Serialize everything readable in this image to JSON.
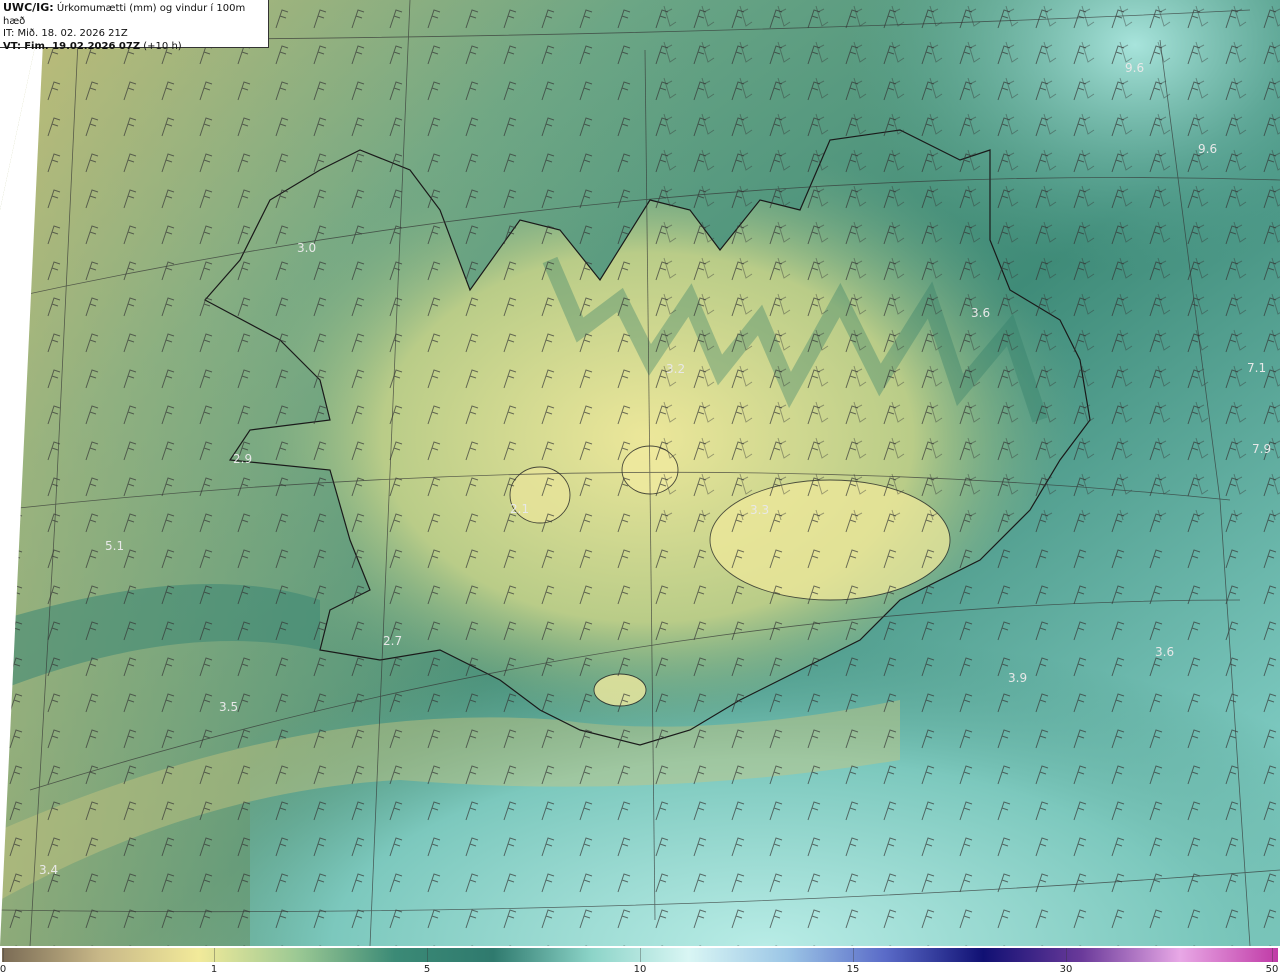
{
  "title": {
    "product": "UWC/IG:",
    "description": "Úrkomumætti (mm) og vindur í 100m hæð",
    "init_time": "IT: Mið. 18. 02. 2026 21Z",
    "valid_label": "VT:",
    "valid_time": "Fim. 19.02.2026 07Z",
    "lead": "(+10 h)"
  },
  "map_labels": [
    {
      "text": "3.0",
      "name": "value-label-westfjords"
    },
    {
      "text": "3.2",
      "name": "value-label-north"
    },
    {
      "text": "3.6",
      "name": "value-label-northeast"
    },
    {
      "text": "7.1",
      "name": "value-label-east-sea"
    },
    {
      "text": "7.9",
      "name": "value-label-east-sea-2"
    },
    {
      "text": "9.6",
      "name": "value-label-northeast-sea"
    },
    {
      "text": "9.6",
      "name": "value-label-far-northeast"
    },
    {
      "text": "2.9",
      "name": "value-label-snaefellsnes"
    },
    {
      "text": "5.1",
      "name": "value-label-west-sea"
    },
    {
      "text": "2.1",
      "name": "value-label-langjokull"
    },
    {
      "text": "3.3",
      "name": "value-label-vatnajokull"
    },
    {
      "text": "2.7",
      "name": "value-label-reykjanes"
    },
    {
      "text": "3.5",
      "name": "value-label-southwest-sea"
    },
    {
      "text": "3.9",
      "name": "value-label-southeast-sea"
    },
    {
      "text": "3.6",
      "name": "value-label-southeast-sea-2"
    },
    {
      "text": "3.4",
      "name": "value-label-south-sea"
    }
  ],
  "colorbar": {
    "ticks": [
      "0",
      "1",
      "5",
      "10",
      "15",
      "30",
      "50"
    ],
    "colors": [
      "#7a6b55",
      "#c8b888",
      "#f2ea9a",
      "#9cc994",
      "#3b8a76",
      "#2f7a6e",
      "#8cd4c8",
      "#d9f6f4",
      "#9cc6e6",
      "#5a6bc8",
      "#101073",
      "#6a3a9a",
      "#e8a8e6",
      "#c03aa6"
    ]
  },
  "accent_colors": {
    "land_light": "#e6e29a",
    "land_mid": "#4f9a80",
    "sea_green": "#3e8c78",
    "sea_cyan": "#9fe0d8",
    "sea_yellow": "#c9c480"
  }
}
